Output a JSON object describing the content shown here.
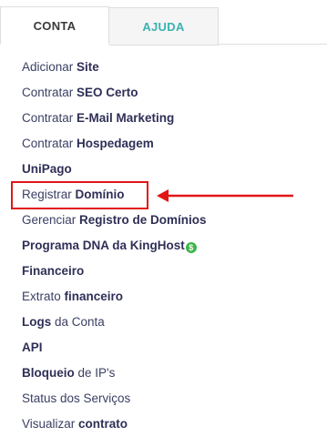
{
  "tabs": [
    {
      "label": "CONTA",
      "active": true
    },
    {
      "label": "AJUDA",
      "active": false
    }
  ],
  "menu": {
    "items": [
      {
        "normal": "Adicionar ",
        "bold": "Site"
      },
      {
        "normal": "Contratar ",
        "bold": "SEO Certo"
      },
      {
        "normal": "Contratar ",
        "bold": "E-Mail Marketing"
      },
      {
        "normal": "Contratar ",
        "bold": "Hospedagem"
      },
      {
        "normal": "",
        "bold": "UniPago"
      },
      {
        "normal": "Registrar ",
        "bold": "Domínio"
      },
      {
        "normal": "Gerenciar ",
        "bold": "Registro de Domínios"
      },
      {
        "normal": "",
        "bold": "Programa DNA da KingHost",
        "badge_icon": "dollar-coin-icon",
        "badge_glyph": "$"
      },
      {
        "normal": "",
        "bold": "Financeiro"
      },
      {
        "normal": "Extrato ",
        "bold": "financeiro"
      },
      {
        "bold": "Logs",
        "normal_after": " da Conta"
      },
      {
        "normal": "",
        "bold": "API"
      },
      {
        "bold": "Bloqueio",
        "normal_after": " de IP's"
      },
      {
        "normal": "Status dos Serviços",
        "bold": ""
      },
      {
        "normal": "Visualizar ",
        "bold": "contrato"
      }
    ]
  },
  "annotation": {
    "highlighted_item": "Registrar Domínio",
    "color": "#e21515"
  },
  "colors": {
    "tab_active_text": "#3a3a3a",
    "tab_inactive_text": "#3ab3b0",
    "menu_text": "#3a3f63",
    "badge": "#3db54a"
  }
}
